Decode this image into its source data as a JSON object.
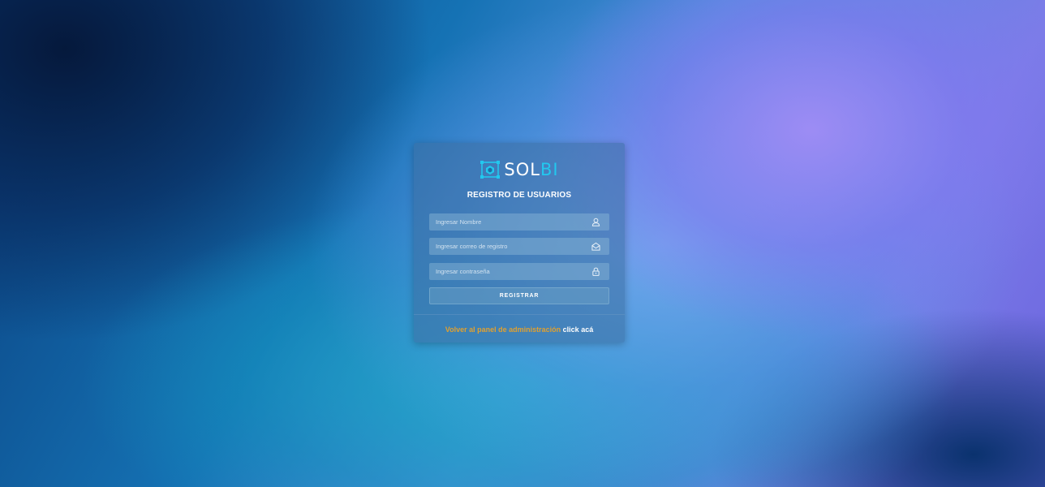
{
  "brand": {
    "name_part1": "SOL",
    "name_part2": "BI",
    "accent_color": "#22c8ef"
  },
  "form": {
    "title": "REGISTRO DE USUARIOS",
    "fields": [
      {
        "placeholder": "Ingresar Nombre",
        "value": "",
        "icon": "user-icon"
      },
      {
        "placeholder": "Ingresar correo de registro",
        "value": "",
        "icon": "envelope-icon"
      },
      {
        "placeholder": "Ingresar contraseña",
        "value": "",
        "icon": "lock-icon"
      }
    ],
    "submit_label": "REGISTRAR"
  },
  "footer": {
    "back_text": "Volver al panel de administración",
    "link_text": "click acá",
    "back_color": "#e0a030"
  }
}
